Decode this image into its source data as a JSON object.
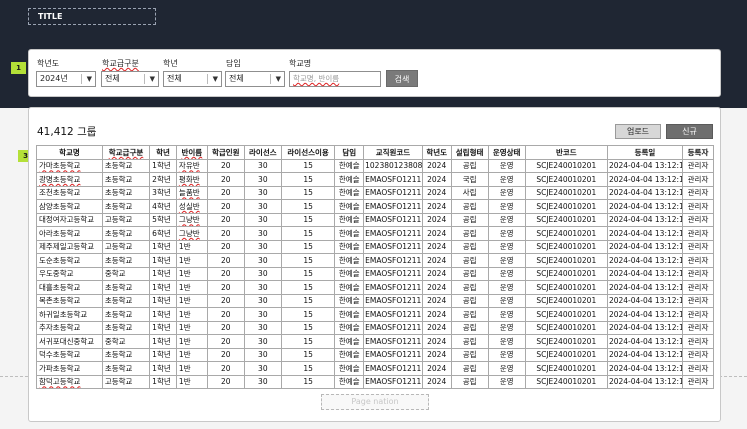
{
  "title": "TITLE",
  "filters": {
    "year_label": "학년도",
    "year_value": "2024년",
    "school_type_label": "학교급구분",
    "school_type_value": "전체",
    "grade_label": "학년",
    "grade_value": "전체",
    "teacher_label": "담임",
    "teacher_value": "전체",
    "school_name_label": "학교명",
    "school_name_placeholder": "학교명, 반이름",
    "search_label": "검색"
  },
  "badges": [
    "1",
    "2",
    "3"
  ],
  "summary": {
    "count": "41,412 그룹"
  },
  "actions": {
    "upload": "업로드",
    "new": "신규"
  },
  "table": {
    "headers": [
      "학교명",
      "학교급구분",
      "학년",
      "반이름",
      "학급인원",
      "라이선스",
      "라이선스이용",
      "담임",
      "교직원코드",
      "학년도",
      "설립형태",
      "운영상태",
      "반코드",
      "등록일",
      "등록자"
    ],
    "rows": [
      [
        "가마초등학교",
        "초등학교",
        "1학년",
        "자유반",
        "20",
        "30",
        "15",
        "한예슬",
        "102380123808",
        "2024",
        "공립",
        "운영",
        "SCJE240010201",
        "2024-04-04 13:12:11",
        "관리자"
      ],
      [
        "광명초등학교",
        "초등학교",
        "2학년",
        "평화반",
        "20",
        "30",
        "15",
        "한예슬",
        "EMAOSFO1211",
        "2024",
        "국립",
        "운영",
        "SCJE240010201",
        "2024-04-04 13:12:11",
        "관리자"
      ],
      [
        "조천초등학교",
        "초등학교",
        "3학년",
        "늘품반",
        "20",
        "30",
        "15",
        "한예슬",
        "EMAOSFO1211",
        "2024",
        "사립",
        "운영",
        "SCJE240010201",
        "2024-04-04 13:12:11",
        "관리자"
      ],
      [
        "삼양초등학교",
        "초등학교",
        "4학년",
        "성실반",
        "20",
        "30",
        "15",
        "한예슬",
        "EMAOSFO1211",
        "2024",
        "공립",
        "운영",
        "SCJE240010201",
        "2024-04-04 13:12:11",
        "관리자"
      ],
      [
        "대정여자고등학교",
        "고등학교",
        "5학년",
        "그냥반",
        "20",
        "30",
        "15",
        "한예슬",
        "EMAOSFO1211",
        "2024",
        "공립",
        "운영",
        "SCJE240010201",
        "2024-04-04 13:12:11",
        "관리자"
      ],
      [
        "아라초등학교",
        "초등학교",
        "6학년",
        "그냥반",
        "20",
        "30",
        "15",
        "한예슬",
        "EMAOSFO1211",
        "2024",
        "공립",
        "운영",
        "SCJE240010201",
        "2024-04-04 13:12:11",
        "관리자"
      ],
      [
        "제주제일고등학교",
        "고등학교",
        "1학년",
        "1반",
        "20",
        "30",
        "15",
        "한예슬",
        "EMAOSFO1211",
        "2024",
        "공립",
        "운영",
        "SCJE240010201",
        "2024-04-04 13:12:11",
        "관리자"
      ],
      [
        "도순초등학교",
        "초등학교",
        "1학년",
        "1반",
        "20",
        "30",
        "15",
        "한예슬",
        "EMAOSFO1211",
        "2024",
        "공립",
        "운영",
        "SCJE240010201",
        "2024-04-04 13:12:11",
        "관리자"
      ],
      [
        "우도중학교",
        "중학교",
        "1학년",
        "1반",
        "20",
        "30",
        "15",
        "한예슬",
        "EMAOSFO1211",
        "2024",
        "공립",
        "운영",
        "SCJE240010201",
        "2024-04-04 13:12:11",
        "관리자"
      ],
      [
        "대흘초등학교",
        "초등학교",
        "1학년",
        "1반",
        "20",
        "30",
        "15",
        "한예슬",
        "EMAOSFO1211",
        "2024",
        "공립",
        "운영",
        "SCJE240010201",
        "2024-04-04 13:12:11",
        "관리자"
      ],
      [
        "복촌초등학교",
        "초등학교",
        "1학년",
        "1반",
        "20",
        "30",
        "15",
        "한예슬",
        "EMAOSFO1211",
        "2024",
        "공립",
        "운영",
        "SCJE240010201",
        "2024-04-04 13:12:11",
        "관리자"
      ],
      [
        "하귀일초등학교",
        "초등학교",
        "1학년",
        "1반",
        "20",
        "30",
        "15",
        "한예슬",
        "EMAOSFO1211",
        "2024",
        "공립",
        "운영",
        "SCJE240010201",
        "2024-04-04 13:12:11",
        "관리자"
      ],
      [
        "추자초등학교",
        "초등학교",
        "1학년",
        "1반",
        "20",
        "30",
        "15",
        "한예슬",
        "EMAOSFO1211",
        "2024",
        "공립",
        "운영",
        "SCJE240010201",
        "2024-04-04 13:12:11",
        "관리자"
      ],
      [
        "서귀포대신중학교",
        "중학교",
        "1학년",
        "1반",
        "20",
        "30",
        "15",
        "한예슬",
        "EMAOSFO1211",
        "2024",
        "공립",
        "운영",
        "SCJE240010201",
        "2024-04-04 13:12:11",
        "관리자"
      ],
      [
        "덕수초등학교",
        "초등학교",
        "1학년",
        "1반",
        "20",
        "30",
        "15",
        "한예슬",
        "EMAOSFO1211",
        "2024",
        "공립",
        "운영",
        "SCJE240010201",
        "2024-04-04 13:12:11",
        "관리자"
      ],
      [
        "가파초등학교",
        "초등학교",
        "1학년",
        "1반",
        "20",
        "30",
        "15",
        "한예슬",
        "EMAOSFO1211",
        "2024",
        "공립",
        "운영",
        "SCJE240010201",
        "2024-04-04 13:12:11",
        "관리자"
      ],
      [
        "함덕고등학교",
        "고등학교",
        "1학년",
        "1반",
        "20",
        "30",
        "15",
        "한예슬",
        "EMAOSFO1211",
        "2024",
        "공립",
        "운영",
        "SCJE240010201",
        "2024-04-04 13:12:11",
        "관리자"
      ]
    ]
  },
  "pagination": {
    "label": "Page nation"
  },
  "colors": {
    "header_bg": "#1f2633",
    "badge": "#b4e038",
    "new_button": "#6e6e6e",
    "search_button": "#7a7a7a"
  }
}
